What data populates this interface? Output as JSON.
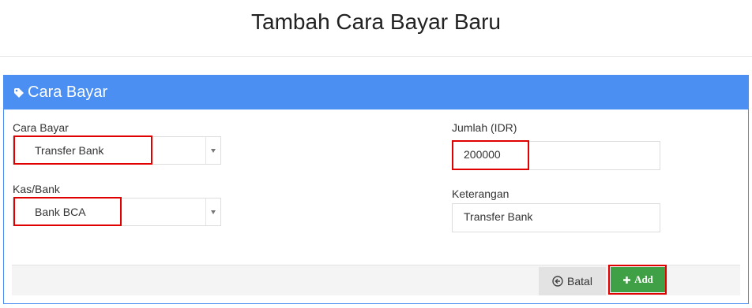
{
  "page": {
    "title": "Tambah Cara Bayar Baru"
  },
  "panel": {
    "heading": "Cara Bayar"
  },
  "form": {
    "payment_method": {
      "label": "Cara Bayar",
      "value": "Transfer Bank"
    },
    "cash_bank": {
      "label": "Kas/Bank",
      "value": "Bank BCA"
    },
    "amount": {
      "label": "Jumlah (IDR)",
      "value": "200000"
    },
    "note": {
      "label": "Keterangan",
      "value": "Transfer Bank"
    }
  },
  "actions": {
    "cancel_label": "Batal",
    "add_label": "Add"
  },
  "colors": {
    "accent": "#4a8ff1",
    "add_button": "#3fa045",
    "highlight": "#e00000"
  },
  "icons": {
    "heading": "tag-icon",
    "cancel": "circle-arrow-left-icon",
    "add": "plus-icon"
  }
}
